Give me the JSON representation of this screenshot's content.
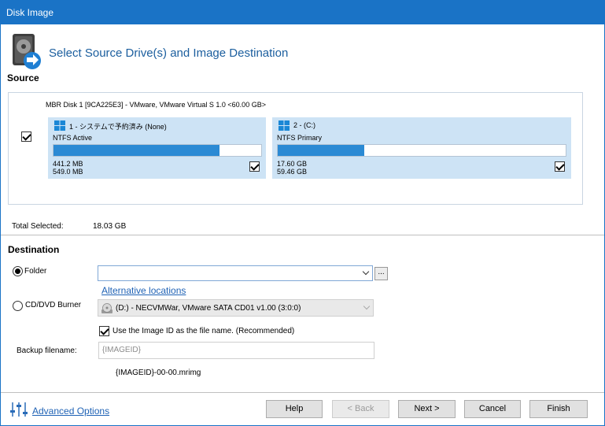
{
  "window": {
    "title": "Disk Image"
  },
  "header": {
    "title": "Select Source Drive(s) and Image Destination",
    "icon": "disk-image-icon"
  },
  "source": {
    "label": "Source",
    "disk_label": "MBR Disk 1 [9CA225E3] - VMware,  VMware Virtual S 1.0  <60.00 GB>",
    "disk_checked": true,
    "partitions": [
      {
        "name": "1 - システムで予約済み (None)",
        "type": "NTFS Active",
        "used": "441.2 MB",
        "total": "549.0 MB",
        "fill_percent": 80,
        "checked": true
      },
      {
        "name": "2 -  (C:)",
        "type": "NTFS Primary",
        "used": "17.60 GB",
        "total": "59.46 GB",
        "fill_percent": 30,
        "checked": true
      }
    ],
    "total_selected_label": "Total Selected:",
    "total_selected_value": "18.03 GB"
  },
  "destination": {
    "label": "Destination",
    "folder_label": "Folder",
    "folder_value": "",
    "browse_label": "...",
    "alternative_locations": "Alternative locations",
    "cd_dvd_label": "CD/DVD Burner",
    "cd_dvd_value": "(D:) - NECVMWar, VMware SATA CD01 v1.00 (3:0:0)",
    "use_image_id_label": "Use the Image ID as the file name.  (Recommended)",
    "use_image_id_checked": true,
    "backup_filename_label": "Backup filename:",
    "backup_filename_value": "{IMAGEID}",
    "filename_preview": "{IMAGEID}-00-00.mrimg"
  },
  "footer": {
    "advanced_options": "Advanced Options",
    "help": "Help",
    "back": "< Back",
    "next": "Next >",
    "cancel": "Cancel",
    "finish": "Finish"
  },
  "colors": {
    "titlebar": "#1a73c6",
    "partition_bg": "#cde3f5",
    "bar_fill": "#2b8ad4",
    "link": "#1f62b5"
  }
}
